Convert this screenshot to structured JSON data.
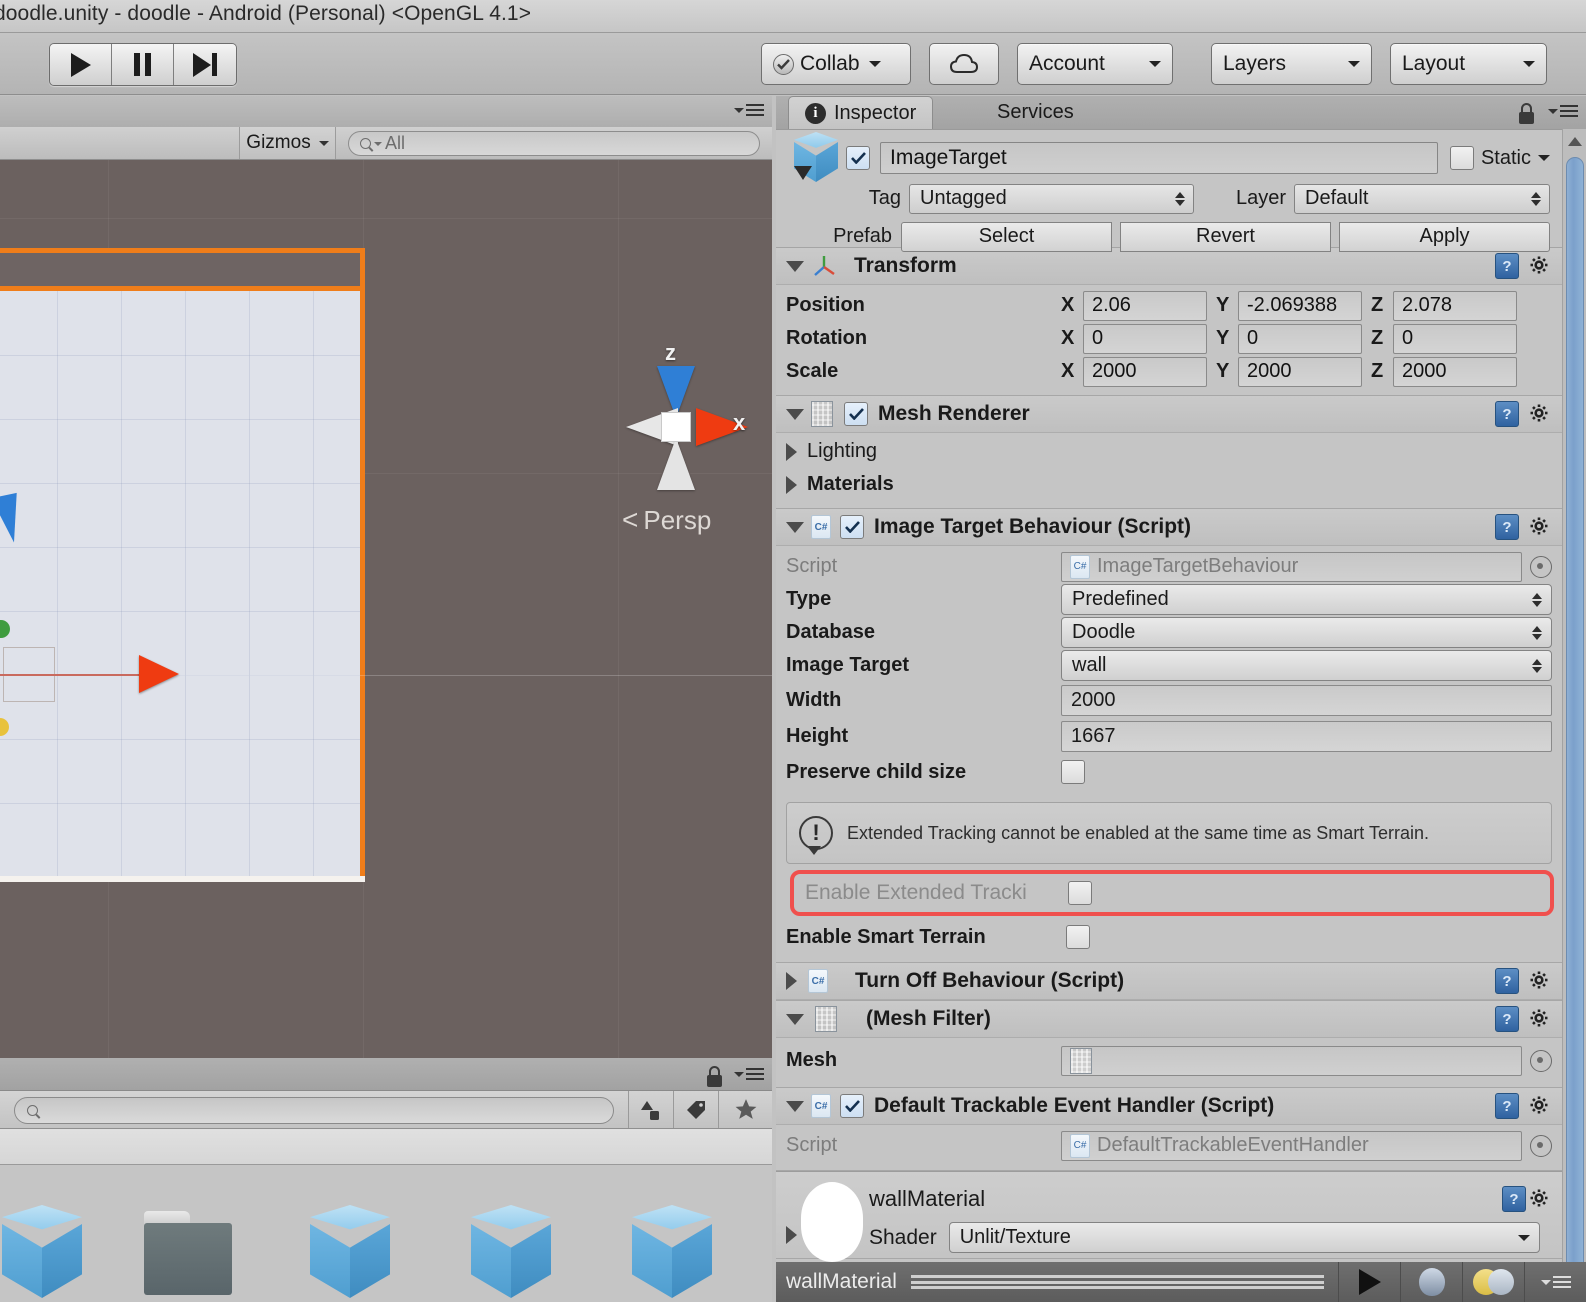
{
  "window": {
    "title": "doodle.unity - doodle - Android (Personal) <OpenGL 4.1>"
  },
  "toolbar": {
    "play_icon": "play-icon",
    "pause_icon": "pause-icon",
    "step_icon": "step-icon",
    "collab_label": "Collab",
    "cloud_icon": "cloud-icon",
    "account_label": "Account",
    "layers_label": "Layers",
    "layout_label": "Layout"
  },
  "scene": {
    "gizmos_label": "Gizmos",
    "search_value": "All",
    "search_icon": "search-icon",
    "compass": {
      "z_label": "z",
      "x_label": "x",
      "projection_label": "Persp"
    },
    "lock_icon": "lock-icon",
    "menu_icon": "panel-menu-icon"
  },
  "project": {
    "search_placeholder": "",
    "search_icon": "search-icon",
    "lock_icon": "lock-icon",
    "menu_icon": "panel-menu-icon",
    "filter_icons": [
      "object-filter-icon",
      "label-filter-icon",
      "favorite-star-icon"
    ],
    "assets": [
      {
        "name": "",
        "icon": "prefab-cube-icon"
      },
      {
        "name": "",
        "icon": "folder-icon"
      },
      {
        "name": "",
        "icon": "prefab-cube-icon"
      },
      {
        "name": "",
        "icon": "prefab-cube-icon"
      },
      {
        "name": "",
        "icon": "prefab-cube-icon"
      }
    ]
  },
  "inspector": {
    "tabs": [
      {
        "label": "Inspector",
        "active": true,
        "icon": "info-icon"
      },
      {
        "label": "Services",
        "active": false
      }
    ],
    "lock_icon": "lock-icon",
    "menu_icon": "panel-menu-icon",
    "object": {
      "enabled": true,
      "name": "ImageTarget",
      "static_label": "Static",
      "static_checked": false,
      "tag_label": "Tag",
      "tag_value": "Untagged",
      "layer_label": "Layer",
      "layer_value": "Default",
      "prefab_label": "Prefab",
      "prefab_buttons": [
        "Select",
        "Revert",
        "Apply"
      ]
    },
    "components": [
      {
        "name": "Transform",
        "expanded": true,
        "rows": [
          {
            "label": "Position",
            "x": "2.06",
            "y": "-2.069388",
            "z": "2.078"
          },
          {
            "label": "Rotation",
            "x": "0",
            "y": "0",
            "z": "0"
          },
          {
            "label": "Scale",
            "x": "2000",
            "y": "2000",
            "z": "2000"
          }
        ],
        "axis_labels": [
          "X",
          "Y",
          "Z"
        ]
      },
      {
        "name": "Mesh Renderer",
        "expanded": true,
        "enabled": true,
        "subsections": [
          "Lighting",
          "Materials"
        ]
      },
      {
        "name": "Image Target Behaviour (Script)",
        "expanded": true,
        "enabled": true,
        "script_label": "Script",
        "script_value": "ImageTargetBehaviour",
        "type_label": "Type",
        "type_value": "Predefined",
        "database_label": "Database",
        "database_value": "Doodle",
        "image_target_label": "Image Target",
        "image_target_value": "wall",
        "width_label": "Width",
        "width_value": "2000",
        "height_label": "Height",
        "height_value": "1667",
        "preserve_label": "Preserve child size",
        "preserve_checked": false,
        "warning_text": "Extended Tracking cannot be enabled at the same time as Smart Terrain.",
        "extended_tracking_label": "Enable Extended Tracki",
        "extended_tracking_checked": false,
        "smart_terrain_label": "Enable Smart Terrain",
        "smart_terrain_checked": false
      },
      {
        "name": "Turn Off Behaviour (Script)",
        "expanded": false
      },
      {
        "name": "(Mesh Filter)",
        "expanded": true,
        "mesh_label": "Mesh",
        "mesh_value": ""
      },
      {
        "name": "Default Trackable Event Handler (Script)",
        "expanded": true,
        "enabled": true,
        "script_label": "Script",
        "script_value": "DefaultTrackableEventHandler"
      }
    ],
    "material": {
      "name": "wallMaterial",
      "shader_label": "Shader",
      "shader_value": "Unlit/Texture"
    }
  },
  "footer": {
    "material_name": "wallMaterial",
    "buttons": [
      "play-preview-icon",
      "sphere-preview-icon",
      "lighting-preview-icon",
      "preview-menu-icon"
    ]
  },
  "colors": {
    "accent_orange": "#ef7d1a",
    "highlight_red": "#f0504d",
    "scene_bg": "#6b615f",
    "panel_bg": "#c5c5c5",
    "scrollbar": "#7ba0cb"
  }
}
